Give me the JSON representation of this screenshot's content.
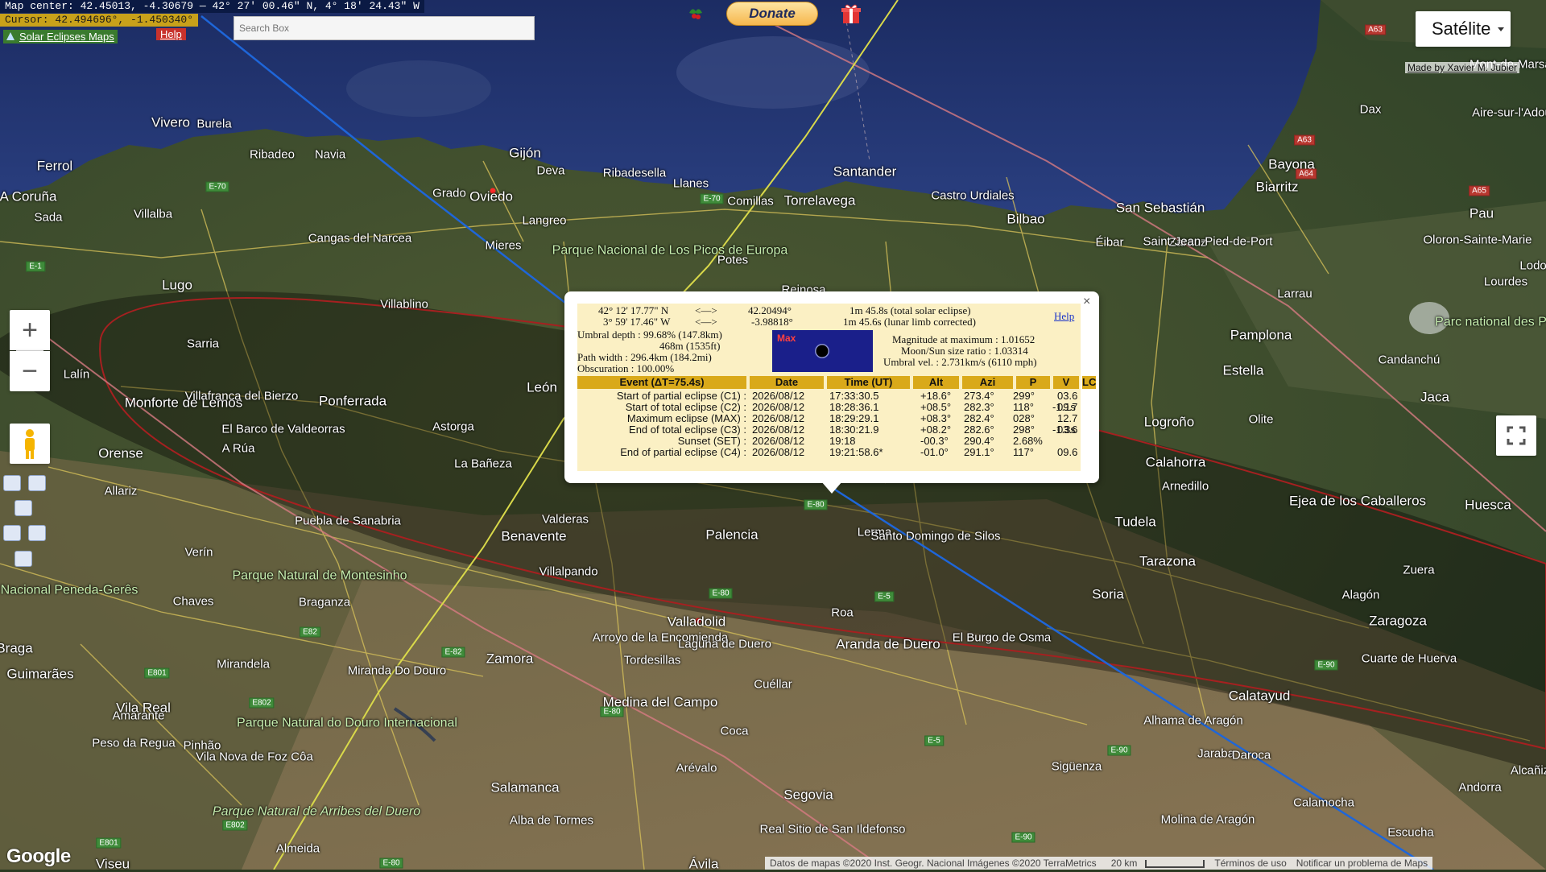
{
  "topbar": {
    "map_center": "Map center: 42.45013, -4.30679 — 42° 27' 00.46\" N, 4° 18' 24.43\" W",
    "cursor": "Cursor: 42.494696°, -1.450340°",
    "solar_maps_link": "Solar Eclipses Maps",
    "help": "Help",
    "search_placeholder": "Search Box",
    "donate": "Donate"
  },
  "map_type": {
    "label": "Satélite"
  },
  "made_by": "Made by Xavier M. Jubier",
  "zoom": {
    "in": "+",
    "out": "−"
  },
  "google_logo": "Google",
  "attribution": {
    "data": "Datos de mapas ©2020 Inst. Geogr. Nacional Imágenes ©2020 TerraMetrics",
    "scale": "20 km",
    "terms": "Términos de uso",
    "report": "Notificar un problema de Maps"
  },
  "popup": {
    "close": "×",
    "lat_dms": "42° 12' 17.77\" N",
    "lon_dms": "3° 59' 17.46\" W",
    "arrow": "<—>",
    "lat_dec": "42.20494°",
    "lon_dec": "-3.98818°",
    "duration": "1m 45.8s (total solar eclipse)",
    "duration_corr": "1m 45.6s (lunar limb corrected)",
    "help": "Help",
    "umbral_depth": "Umbral depth : 99.68% (147.8km)",
    "umbral_depth2": "468m (1535ft)",
    "path_width": "Path width : 296.4km (184.2mi)",
    "obscuration": "Obscuration : 100.00%",
    "max_label": "Max",
    "magnitude": "Magnitude at maximum : 1.01652",
    "moon_sun": "Moon/Sun size ratio : 1.03314",
    "umbral_vel": "Umbral vel. : 2.731km/s (6110 mph)",
    "table": {
      "headers": [
        "Event (ΔT=75.4s)",
        "Date",
        "Time (UT)",
        "Alt",
        "Azi",
        "P",
        "V",
        "LC"
      ],
      "rows": [
        [
          "Start of partial eclipse (C1) :",
          "2026/08/12",
          "17:33:30.5",
          "+18.6°",
          "273.4°",
          "299°",
          "03.6",
          ""
        ],
        [
          "Start of total eclipse (C2) :",
          "2026/08/12",
          "18:28:36.1",
          "+08.5°",
          "282.3°",
          "118°",
          "09.7",
          "-1.1s"
        ],
        [
          "Maximum eclipse (MAX) :",
          "2026/08/12",
          "18:29:29.1",
          "+08.3°",
          "282.4°",
          "028°",
          "12.7",
          ""
        ],
        [
          "End of total eclipse (C3) :",
          "2026/08/12",
          "18:30:21.9",
          "+08.2°",
          "282.6°",
          "298°",
          "03.6",
          "-1.3s"
        ],
        [
          "Sunset (SET) :",
          "2026/08/12",
          "19:18",
          "-00.3°",
          "290.4°",
          "2.68%",
          "",
          ""
        ],
        [
          "End of partial eclipse (C4) :",
          "2026/08/12",
          "19:21:58.6*",
          "-01.0°",
          "291.1°",
          "117°",
          "09.6",
          ""
        ]
      ]
    }
  },
  "places": [
    {
      "n": "Vivero",
      "c": "big"
    },
    {
      "n": "Burela"
    },
    {
      "n": "Ferrol",
      "c": "big"
    },
    {
      "n": "Ribadeo"
    },
    {
      "n": "Navia"
    },
    {
      "n": "Gijón",
      "c": "big"
    },
    {
      "n": "Deva"
    },
    {
      "n": "Ribadesella"
    },
    {
      "n": "Llanes"
    },
    {
      "n": "Santander",
      "c": "big"
    },
    {
      "n": "Castro Urdiales"
    },
    {
      "n": "Bilbao",
      "c": "big"
    },
    {
      "n": "Dax"
    },
    {
      "n": "Aire-sur-l'Adour"
    },
    {
      "n": "Bayona",
      "c": "big"
    },
    {
      "n": "Biarritz",
      "c": "big"
    },
    {
      "n": "San Sebastián",
      "c": "big"
    },
    {
      "n": "Pau",
      "c": "big"
    },
    {
      "n": "A Coruña",
      "c": "big"
    },
    {
      "n": "Sada"
    },
    {
      "n": "Villalba"
    },
    {
      "n": "Grado"
    },
    {
      "n": "Oviedo",
      "c": "big"
    },
    {
      "n": "Langreo"
    },
    {
      "n": "Mieres"
    },
    {
      "n": "Comillas"
    },
    {
      "n": "Torrelavega",
      "c": "big"
    },
    {
      "n": "Éibar"
    },
    {
      "n": "Zarauz"
    },
    {
      "n": "Saint-Jean-Pied-de-Port"
    },
    {
      "n": "Oloron-Sainte-Marie"
    },
    {
      "n": "Cangas del Narcea"
    },
    {
      "n": "Parque Nacional de Los Picos de Europa",
      "c": "park"
    },
    {
      "n": "Potes"
    },
    {
      "n": "Lugo",
      "c": "big"
    },
    {
      "n": "Villablino"
    },
    {
      "n": "Reinosa"
    },
    {
      "n": "Pamplona",
      "c": "big"
    },
    {
      "n": "Larrau"
    },
    {
      "n": "Sarria"
    },
    {
      "n": "Lalín"
    },
    {
      "n": "Monforte de Lemos",
      "c": "big"
    },
    {
      "n": "Villafranca del Bierzo"
    },
    {
      "n": "Ponferrada",
      "c": "big"
    },
    {
      "n": "León",
      "c": "big"
    },
    {
      "n": "Estella",
      "c": "big"
    },
    {
      "n": "Candanchú"
    },
    {
      "n": "Jaca",
      "c": "big"
    },
    {
      "n": "El Barco de Valdeorras"
    },
    {
      "n": "Astorga"
    },
    {
      "n": "Logroño",
      "c": "big"
    },
    {
      "n": "Olite"
    },
    {
      "n": "Orense",
      "c": "big"
    },
    {
      "n": "A Rúa"
    },
    {
      "n": "La Bañeza"
    },
    {
      "n": "Calahorra",
      "c": "big"
    },
    {
      "n": "Arnedillo"
    },
    {
      "n": "Allariz"
    },
    {
      "n": "Puebla de Sanabria"
    },
    {
      "n": "Valderas"
    },
    {
      "n": "Benavente",
      "c": "big"
    },
    {
      "n": "Palencia",
      "c": "big"
    },
    {
      "n": "Lerma"
    },
    {
      "n": "Santo Domingo de Silos"
    },
    {
      "n": "Tudela",
      "c": "big"
    },
    {
      "n": "Ejea de los Caballeros",
      "c": "big"
    },
    {
      "n": "Huesca",
      "c": "big"
    },
    {
      "n": "Verín"
    },
    {
      "n": "Parque Natural de Montesinho",
      "c": "park"
    },
    {
      "n": "Villalpando"
    },
    {
      "n": "Tarazona",
      "c": "big"
    },
    {
      "n": "Zuera"
    },
    {
      "n": "Parque Nacional Peneda-Gerês",
      "c": "park"
    },
    {
      "n": "Chaves"
    },
    {
      "n": "Braganza"
    },
    {
      "n": "Soria",
      "c": "big"
    },
    {
      "n": "Alagón"
    },
    {
      "n": "Roa"
    },
    {
      "n": "Zaragoza",
      "c": "big"
    },
    {
      "n": "Valladolid",
      "c": "big"
    },
    {
      "n": "Aranda de Duero",
      "c": "big"
    },
    {
      "n": "El Burgo de Osma"
    },
    {
      "n": "Braga",
      "c": "big"
    },
    {
      "n": "Zamora",
      "c": "big"
    },
    {
      "n": "Arroyo de la Encomienda"
    },
    {
      "n": "Laguna de Duero"
    },
    {
      "n": "Tordesillas"
    },
    {
      "n": "Cuarte de Huerva"
    },
    {
      "n": "Guimarães",
      "c": "big"
    },
    {
      "n": "Mirandela"
    },
    {
      "n": "Miranda Do Douro"
    },
    {
      "n": "Calatayud",
      "c": "big"
    },
    {
      "n": "Vila Real",
      "c": "big"
    },
    {
      "n": "Parque Natural do Douro Internacional",
      "c": "park"
    },
    {
      "n": "Medina del Campo",
      "c": "big"
    },
    {
      "n": "Cuéllar"
    },
    {
      "n": "Alhama de Aragón"
    },
    {
      "n": "Amarante"
    },
    {
      "n": "Peso da Regua"
    },
    {
      "n": "Pinhão"
    },
    {
      "n": "Vila Nova de Foz Côa"
    },
    {
      "n": "Coca"
    },
    {
      "n": "Jaraba"
    },
    {
      "n": "Daroca"
    },
    {
      "n": "Arévalo"
    },
    {
      "n": "Sigüenza"
    },
    {
      "n": "Salamanca",
      "c": "big"
    },
    {
      "n": "Segovia",
      "c": "big"
    },
    {
      "n": "Andorra"
    },
    {
      "n": "Parque Natural de Arribes del Duero",
      "c": "parki"
    },
    {
      "n": "Alba de Tormes"
    },
    {
      "n": "Real Sitio de San Ildefonso"
    },
    {
      "n": "Calamocha"
    },
    {
      "n": "Molina de Aragón"
    },
    {
      "n": "Almeida"
    },
    {
      "n": "Escucha"
    },
    {
      "n": "Viseu",
      "c": "big"
    },
    {
      "n": "Ávila",
      "c": "big"
    },
    {
      "n": "Mont-de-Marsan"
    },
    {
      "n": "Lourdes"
    },
    {
      "n": "Parc national des Pyrénées",
      "c": "park"
    },
    {
      "n": "Lodosa"
    },
    {
      "n": "Alcañiz"
    }
  ],
  "roads": [
    {
      "n": "E-70"
    },
    {
      "n": "E-1"
    },
    {
      "n": "E-70"
    },
    {
      "n": "A63",
      "c": "red"
    },
    {
      "n": "A63",
      "c": "red"
    },
    {
      "n": "A64",
      "c": "red"
    },
    {
      "n": "A65",
      "c": "red"
    },
    {
      "n": "E-80"
    },
    {
      "n": "E-80"
    },
    {
      "n": "E-5"
    },
    {
      "n": "E-82"
    },
    {
      "n": "E82"
    },
    {
      "n": "E801"
    },
    {
      "n": "E802"
    },
    {
      "n": "E-80"
    },
    {
      "n": "E-5"
    },
    {
      "n": "E-90"
    },
    {
      "n": "E-90"
    },
    {
      "n": "E802"
    },
    {
      "n": "E801"
    },
    {
      "n": "E-80"
    },
    {
      "n": "E-90"
    }
  ]
}
